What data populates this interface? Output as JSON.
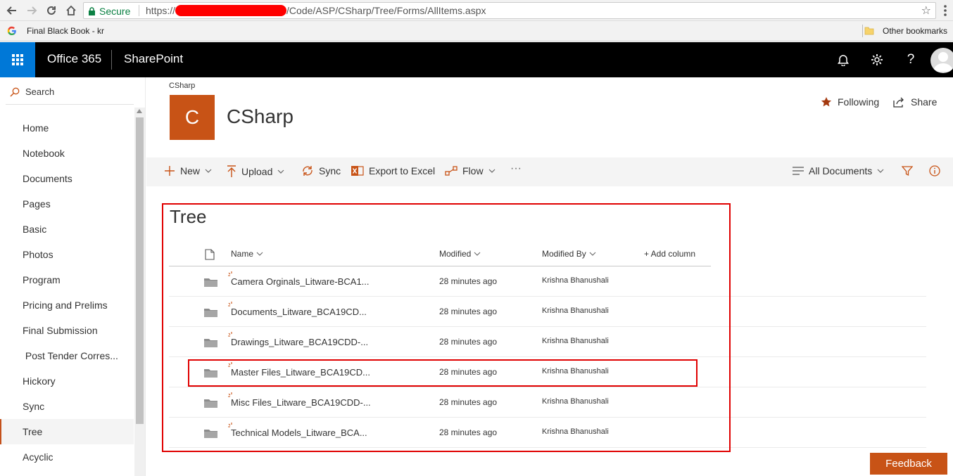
{
  "browser": {
    "secure_label": "Secure",
    "url_prefix": "https://",
    "url_path": "/Code/ASP/CSharp/Tree/Forms/AllItems.aspx",
    "bookmark_left": "Final Black Book - kr",
    "bookmark_right": "Other bookmarks"
  },
  "suite": {
    "brand": "Office 365",
    "app": "SharePoint"
  },
  "leftnav": {
    "search_label": "Search",
    "items": [
      {
        "label": "Home"
      },
      {
        "label": "Notebook"
      },
      {
        "label": "Documents"
      },
      {
        "label": "Pages"
      },
      {
        "label": "Basic"
      },
      {
        "label": "Photos"
      },
      {
        "label": "Program"
      },
      {
        "label": "Pricing and Prelims"
      },
      {
        "label": "Final Submission"
      },
      {
        "label": " Post Tender Corres..."
      },
      {
        "label": "Hickory"
      },
      {
        "label": "Sync"
      },
      {
        "label": "Tree"
      },
      {
        "label": "Acyclic"
      }
    ],
    "active": "Tree"
  },
  "site": {
    "breadcrumb": "CSharp",
    "logo_letter": "C",
    "title": "CSharp",
    "following_label": "Following",
    "share_label": "Share"
  },
  "commandbar": {
    "new_label": "New",
    "upload_label": "Upload",
    "sync_label": "Sync",
    "export_label": "Export to Excel",
    "flow_label": "Flow",
    "more_label": "···",
    "view_label": "All Documents"
  },
  "list": {
    "title": "Tree",
    "columns": {
      "name": "Name",
      "modified": "Modified",
      "modified_by": "Modified By",
      "add_column": "+ Add column"
    },
    "rows": [
      {
        "name": "Camera Orginals_Litware-BCA1...",
        "modified": "28 minutes ago",
        "modified_by": "Krishna Bhanushali"
      },
      {
        "name": "Documents_Litware_BCA19CD...",
        "modified": "28 minutes ago",
        "modified_by": "Krishna Bhanushali"
      },
      {
        "name": "Drawings_Litware_BCA19CDD-...",
        "modified": "28 minutes ago",
        "modified_by": "Krishna Bhanushali"
      },
      {
        "name": "Master Files_Litware_BCA19CD...",
        "modified": "28 minutes ago",
        "modified_by": "Krishna Bhanushali"
      },
      {
        "name": "Misc Files_Litware_BCA19CDD-...",
        "modified": "28 minutes ago",
        "modified_by": "Krishna Bhanushali"
      },
      {
        "name": "Technical Models_Litware_BCA...",
        "modified": "28 minutes ago",
        "modified_by": "Krishna Bhanushali"
      }
    ]
  },
  "feedback_label": "Feedback",
  "colors": {
    "accent": "#c85316",
    "waffle": "#0078d7",
    "suitebar": "#000000",
    "annotation": "#e00000"
  }
}
